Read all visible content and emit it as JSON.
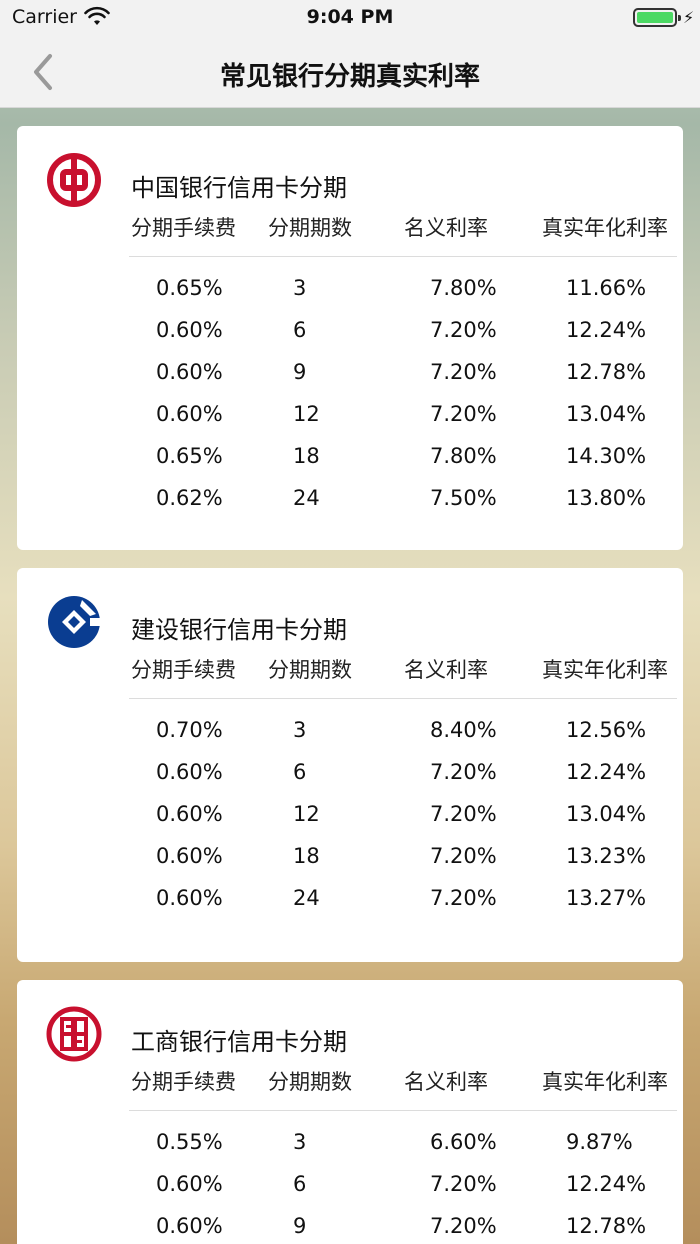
{
  "status_bar": {
    "carrier": "Carrier",
    "time": "9:04 PM"
  },
  "nav": {
    "title": "常见银行分期真实利率"
  },
  "headers": {
    "fee": "分期手续费",
    "periods": "分期期数",
    "nominal": "名义利率",
    "real": "真实年化利率"
  },
  "banks": [
    {
      "name": "中国银行信用卡分期",
      "logo": "boc-logo-icon",
      "color": "#c8102e",
      "rows": [
        {
          "fee": "0.65%",
          "periods": "3",
          "nominal": "7.80%",
          "real": "11.66%"
        },
        {
          "fee": "0.60%",
          "periods": "6",
          "nominal": "7.20%",
          "real": "12.24%"
        },
        {
          "fee": "0.60%",
          "periods": "9",
          "nominal": "7.20%",
          "real": "12.78%"
        },
        {
          "fee": "0.60%",
          "periods": "12",
          "nominal": "7.20%",
          "real": "13.04%"
        },
        {
          "fee": "0.65%",
          "periods": "18",
          "nominal": "7.80%",
          "real": "14.30%"
        },
        {
          "fee": "0.62%",
          "periods": "24",
          "nominal": "7.50%",
          "real": "13.80%"
        }
      ]
    },
    {
      "name": "建设银行信用卡分期",
      "logo": "ccb-logo-icon",
      "color": "#0a3d91",
      "rows": [
        {
          "fee": "0.70%",
          "periods": "3",
          "nominal": "8.40%",
          "real": "12.56%"
        },
        {
          "fee": "0.60%",
          "periods": "6",
          "nominal": "7.20%",
          "real": "12.24%"
        },
        {
          "fee": "0.60%",
          "periods": "12",
          "nominal": "7.20%",
          "real": "13.04%"
        },
        {
          "fee": "0.60%",
          "periods": "18",
          "nominal": "7.20%",
          "real": "13.23%"
        },
        {
          "fee": "0.60%",
          "periods": "24",
          "nominal": "7.20%",
          "real": "13.27%"
        }
      ]
    },
    {
      "name": "工商银行信用卡分期",
      "logo": "icbc-logo-icon",
      "color": "#c8102e",
      "rows": [
        {
          "fee": "0.55%",
          "periods": "3",
          "nominal": "6.60%",
          "real": "9.87%"
        },
        {
          "fee": "0.60%",
          "periods": "6",
          "nominal": "7.20%",
          "real": "12.24%"
        },
        {
          "fee": "0.60%",
          "periods": "9",
          "nominal": "7.20%",
          "real": "12.78%"
        }
      ]
    }
  ]
}
